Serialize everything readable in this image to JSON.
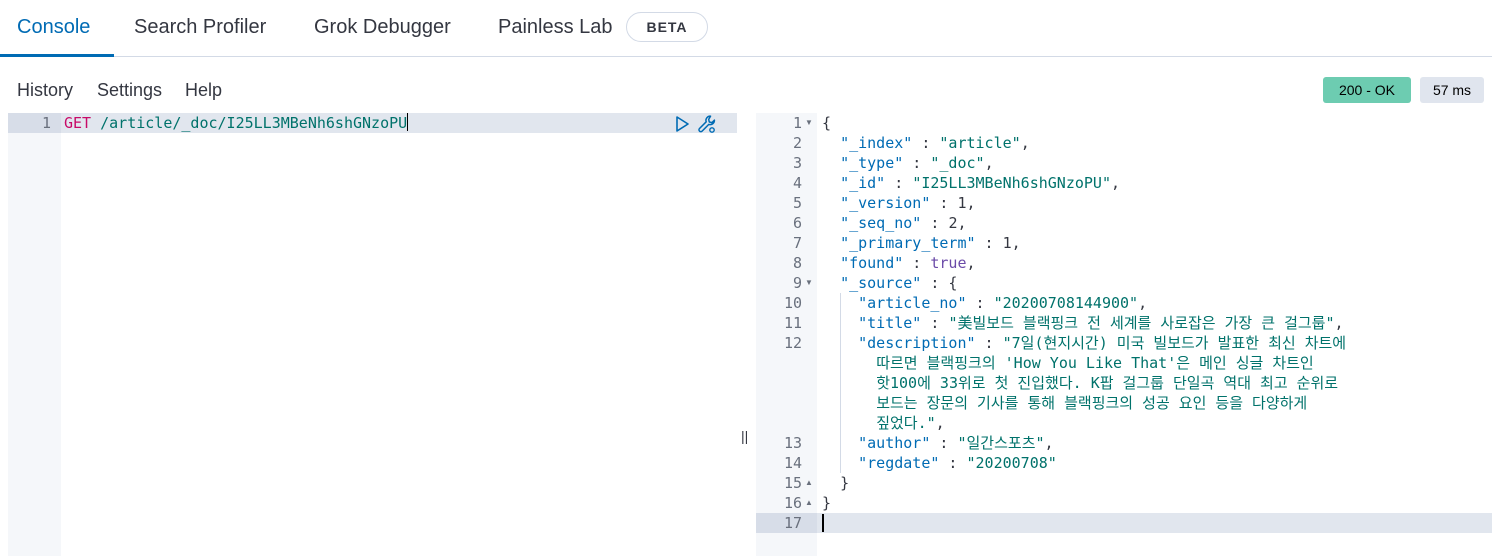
{
  "tabs": [
    {
      "label": "Console"
    },
    {
      "label": "Search Profiler"
    },
    {
      "label": "Grok Debugger"
    },
    {
      "label": "Painless Lab"
    }
  ],
  "beta_badge": "BETA",
  "menu": {
    "history": "History",
    "settings": "Settings",
    "help": "Help"
  },
  "status": {
    "code": "200 - OK",
    "time": "57 ms"
  },
  "request": {
    "line_number": "1",
    "method": "GET",
    "url": "/article/_doc/I25LL3MBeNh6shGNzoPU"
  },
  "response": {
    "line_numbers": [
      "1",
      "2",
      "3",
      "4",
      "5",
      "6",
      "7",
      "8",
      "9",
      "10",
      "11",
      "12",
      "13",
      "14",
      "15",
      "16",
      "17"
    ],
    "open_brace": "{",
    "index_key": "\"_index\"",
    "index_val": "\"article\"",
    "type_key": "\"_type\"",
    "type_val": "\"_doc\"",
    "id_key": "\"_id\"",
    "id_val": "\"I25LL3MBeNh6shGNzoPU\"",
    "version_key": "\"_version\"",
    "version_val": "1",
    "seq_no_key": "\"_seq_no\"",
    "seq_no_val": "2",
    "primary_term_key": "\"_primary_term\"",
    "primary_term_val": "1",
    "found_key": "\"found\"",
    "found_val": "true",
    "source_key": "\"_source\"",
    "article_no_key": "\"article_no\"",
    "article_no_val": "\"20200708144900\"",
    "title_key": "\"title\"",
    "title_val": "\"美빌보드 블랙핑크 전 세계를 사로잡은 가장 큰 걸그룹\"",
    "description_key": "\"description\"",
    "description_val_lines": [
      "\"7일(현지시간) 미국 빌보드가 발표한 최신 차트에",
      "따르면 블랙핑크의 'How You Like That'은 메인 싱글 차트인",
      "핫100에 33위로 첫 진입했다. K팝 걸그룹 단일곡 역대 최고 순위로",
      "보드는 장문의 기사를 통해 블랙핑크의 성공 요인 등을 다양하게",
      "짚었다.\""
    ],
    "author_key": "\"author\"",
    "author_val": "\"일간스포츠\"",
    "regdate_key": "\"regdate\"",
    "regdate_val": "\"20200708\"",
    "close_inner": "}",
    "close_outer": "}"
  }
}
